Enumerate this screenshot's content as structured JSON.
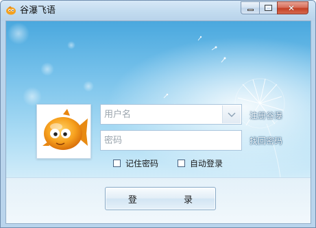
{
  "window": {
    "title": "谷瀑飞语",
    "icon": "fish-icon",
    "controls": {
      "minimize": "minimize-icon",
      "maximize": "maximize-icon",
      "close": "close-icon"
    }
  },
  "login": {
    "avatar": "fish-avatar",
    "username_placeholder": "用户名",
    "password_placeholder": "密码",
    "register_link": "注册谷瀑",
    "forgot_link": "找回密码",
    "remember_password": {
      "label": "记住密码",
      "checked": false
    },
    "auto_login": {
      "label": "自动登录",
      "checked": false
    },
    "login_button": "登 录"
  },
  "colors": {
    "accent": "#4aa8de",
    "fish_orange": "#f59a1e"
  }
}
